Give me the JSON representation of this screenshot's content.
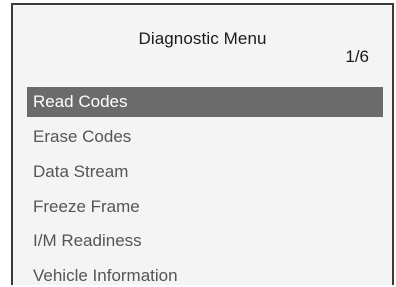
{
  "header": {
    "title": "Diagnostic Menu",
    "page_indicator": "1/6"
  },
  "menu": {
    "selected_index": 0,
    "items": [
      {
        "label": "Read Codes"
      },
      {
        "label": "Erase Codes"
      },
      {
        "label": "Data Stream"
      },
      {
        "label": "Freeze Frame"
      },
      {
        "label": "I/M Readiness"
      },
      {
        "label": "Vehicle Information"
      }
    ]
  },
  "colors": {
    "selection_background": "#6b6b6b",
    "selection_text": "#ffffff",
    "item_text": "#555555",
    "screen_background": "#f4f4f4"
  }
}
